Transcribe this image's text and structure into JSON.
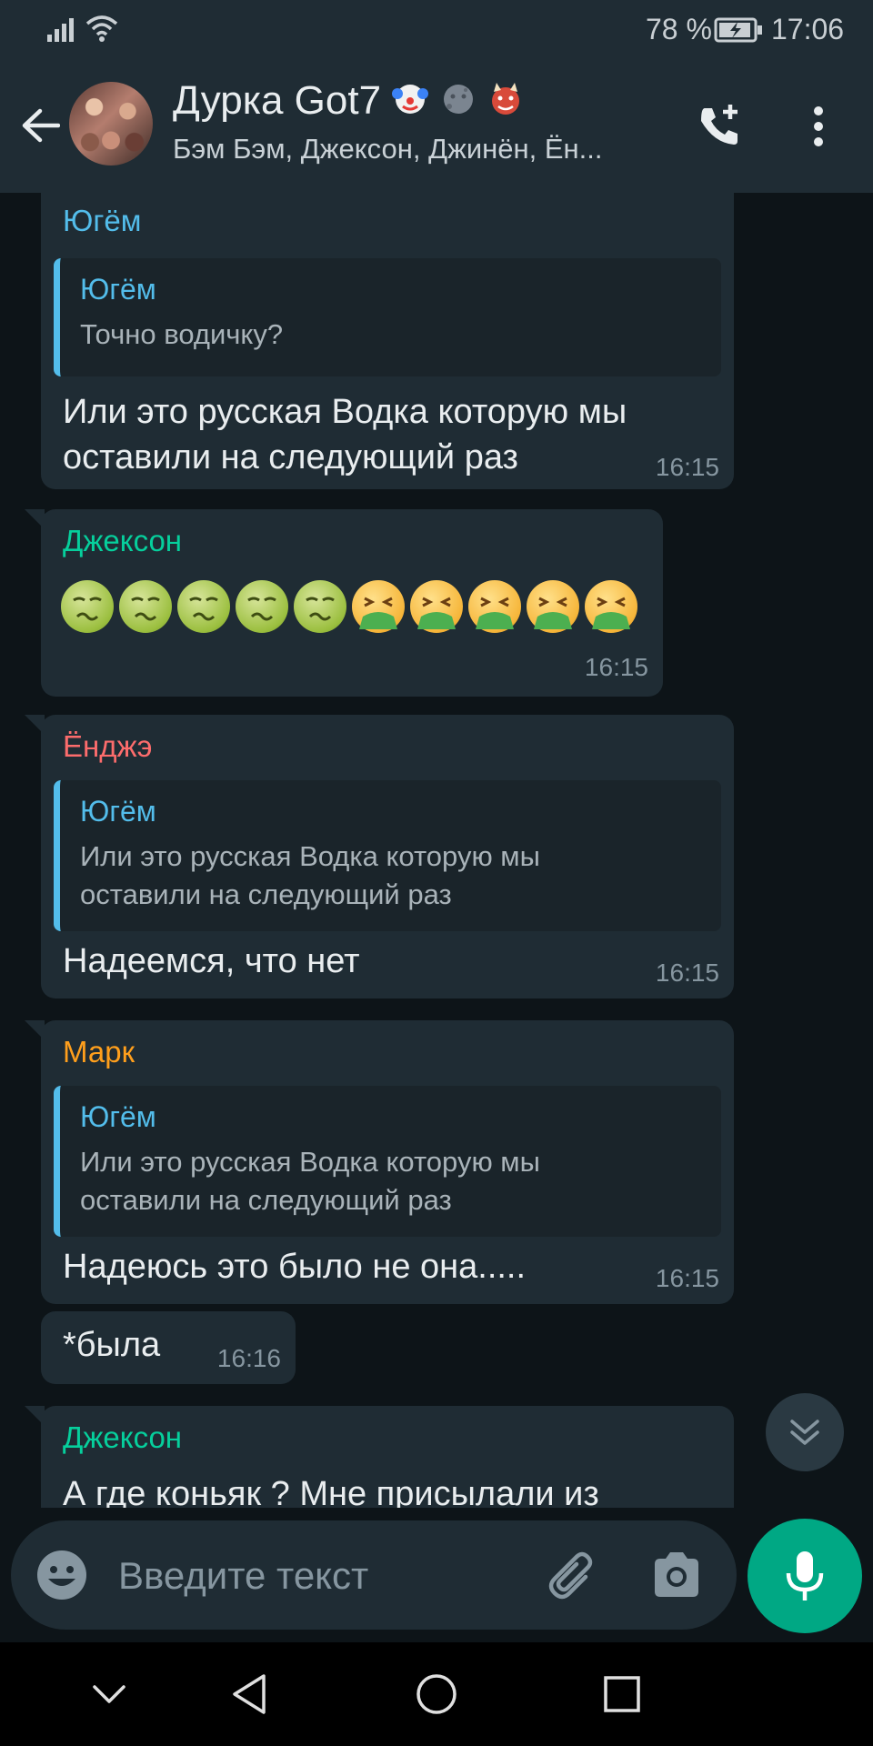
{
  "status_bar": {
    "battery_percent": "78 %",
    "time": "17:06"
  },
  "header": {
    "title": "Дурка Got7",
    "title_emojis": [
      "clown-emoji",
      "new-moon-face-emoji",
      "ogre-emoji"
    ],
    "subtitle": "Бэм Бэм, Джексон, Джинён, Ён..."
  },
  "messages": [
    {
      "sender": "Югём",
      "sender_color": "#53bdeb",
      "quote": {
        "author": "Югём",
        "text": "Точно водичку?"
      },
      "text": "Или это русская Водка которую мы оставили на следующий раз",
      "time": "16:15"
    },
    {
      "sender": "Джексон",
      "sender_color": "#06cf9c",
      "emoji_sequence": [
        "nauseated",
        "nauseated",
        "nauseated",
        "nauseated",
        "nauseated",
        "vomiting",
        "vomiting",
        "vomiting",
        "vomiting",
        "vomiting"
      ],
      "time": "16:15"
    },
    {
      "sender": "Ёнджэ",
      "sender_color": "#fc6c6c",
      "quote": {
        "author": "Югём",
        "text": "Или это русская Водка которую мы оставили на следующий раз"
      },
      "text": "Надеемся, что нет",
      "time": "16:15"
    },
    {
      "sender": "Марк",
      "sender_color": "#ff9f1c",
      "quote": {
        "author": "Югём",
        "text": "Или это русская Водка которую мы оставили на следующий раз"
      },
      "text": "Надеюсь это было не она.....",
      "time": "16:15"
    },
    {
      "text": "*была",
      "time": "16:16"
    },
    {
      "sender": "Джексон",
      "sender_color": "#06cf9c",
      "text": "А где коньяк ? Мне присылали из"
    }
  ],
  "input": {
    "placeholder": "Введите текст"
  },
  "colors": {
    "accent": "#00a884",
    "bubble": "#1f2c34",
    "background": "#0d1418",
    "quote_bar": "#53bdeb"
  }
}
